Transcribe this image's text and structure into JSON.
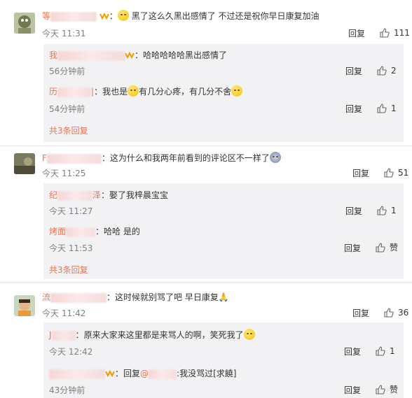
{
  "comments": [
    {
      "user": "等",
      "text": "黑了这么久黑出感情了 不过还是祝你早日康复加油",
      "time": "今天 11:31",
      "reply_label": "回复",
      "likes": "111",
      "replies": [
        {
          "user": "我",
          "text": "哈哈哈哈哈黑出感情了",
          "time": "56分钟前",
          "reply_label": "回复",
          "likes": "2"
        },
        {
          "user": "历",
          "text_a": "我也是",
          "text_b": "有几分心疼，有几分不舍",
          "time": "54分钟前",
          "reply_label": "回复",
          "likes": "1"
        }
      ],
      "total_replies": "共3条回复"
    },
    {
      "user": "F",
      "text": "这为什么和我两年前看到的评论区不一样了",
      "time": "今天 11:25",
      "reply_label": "回复",
      "likes": "51",
      "replies": [
        {
          "user": "纪",
          "user_tail": "泽",
          "text": "娶了我梓晨宝宝",
          "time": "今天 11:27",
          "reply_label": "回复",
          "likes": "1"
        },
        {
          "user": "烤面",
          "text": "哈哈 是的",
          "time": "今天 11:53",
          "reply_label": "回复",
          "likes": "赞"
        }
      ],
      "total_replies": "共3条回复"
    },
    {
      "user": "流",
      "text": "这时候就别骂了吧 早日康复",
      "time": "今天 11:42",
      "reply_label": "回复",
      "likes": "36",
      "replies": [
        {
          "user": "J",
          "text": "原来大家来这里都是来骂人的啊，笑死我了",
          "time": "今天 12:42",
          "reply_label": "回复",
          "likes": "1"
        },
        {
          "user": "",
          "text_a": "回复",
          "mention": "@",
          "text_b": ":我没骂过[求饒]",
          "time": "43分钟前",
          "reply_label": "回复",
          "likes": "赞"
        }
      ]
    }
  ],
  "colors": {
    "username": "#eb7350",
    "meta": "#808080",
    "reply_bg": "#f2f2f5"
  }
}
